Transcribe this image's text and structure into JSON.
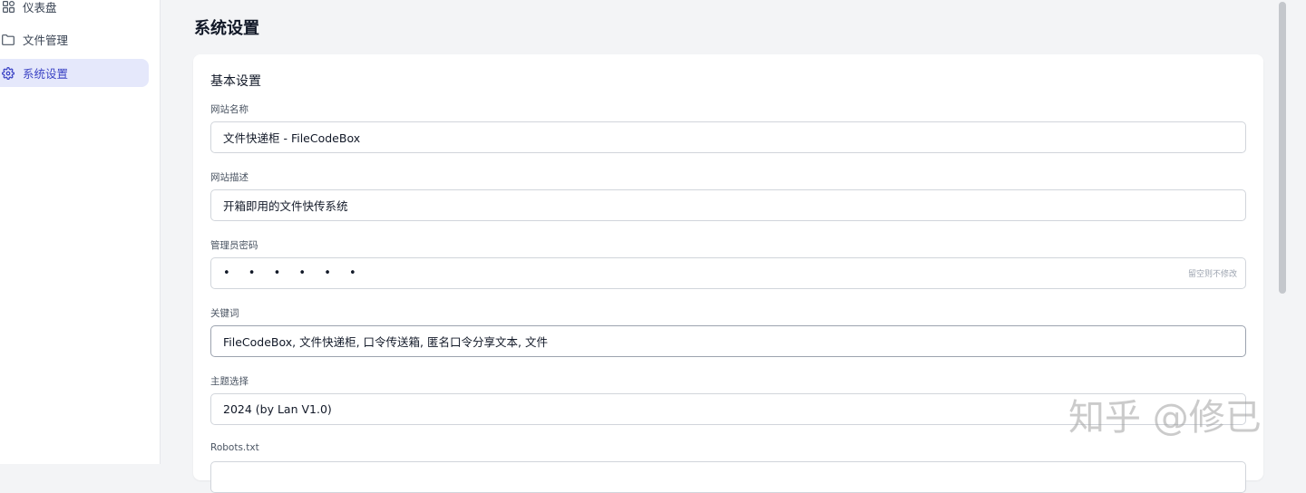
{
  "sidebar": {
    "items": [
      {
        "label": "仪表盘",
        "icon": "dashboard-icon",
        "active": false
      },
      {
        "label": "文件管理",
        "icon": "folder-icon",
        "active": false
      },
      {
        "label": "系统设置",
        "icon": "gear-icon",
        "active": true
      }
    ]
  },
  "header": {
    "title": "系统设置"
  },
  "settings": {
    "section_title": "基本设置",
    "site_name": {
      "label": "网站名称",
      "value": "文件快递柜 - FileCodeBox"
    },
    "site_description": {
      "label": "网站描述",
      "value": "开箱即用的文件快传系统"
    },
    "admin_password": {
      "label": "管理员密码",
      "value": "• • • • • •",
      "hint": "留空则不修改"
    },
    "keywords": {
      "label": "关键词",
      "value": "FileCodeBox, 文件快递柜, 口令传送箱, 匿名口令分享文本, 文件"
    },
    "theme": {
      "label": "主题选择",
      "value": "2024 (by Lan V1.0)"
    },
    "robots": {
      "label": "Robots.txt"
    }
  },
  "watermark": {
    "text": "知乎 @修已"
  },
  "colors": {
    "accent": "#3b43c4",
    "active_bg": "#e5e8fb",
    "page_bg": "#f3f4f6",
    "card_bg": "#ffffff"
  }
}
